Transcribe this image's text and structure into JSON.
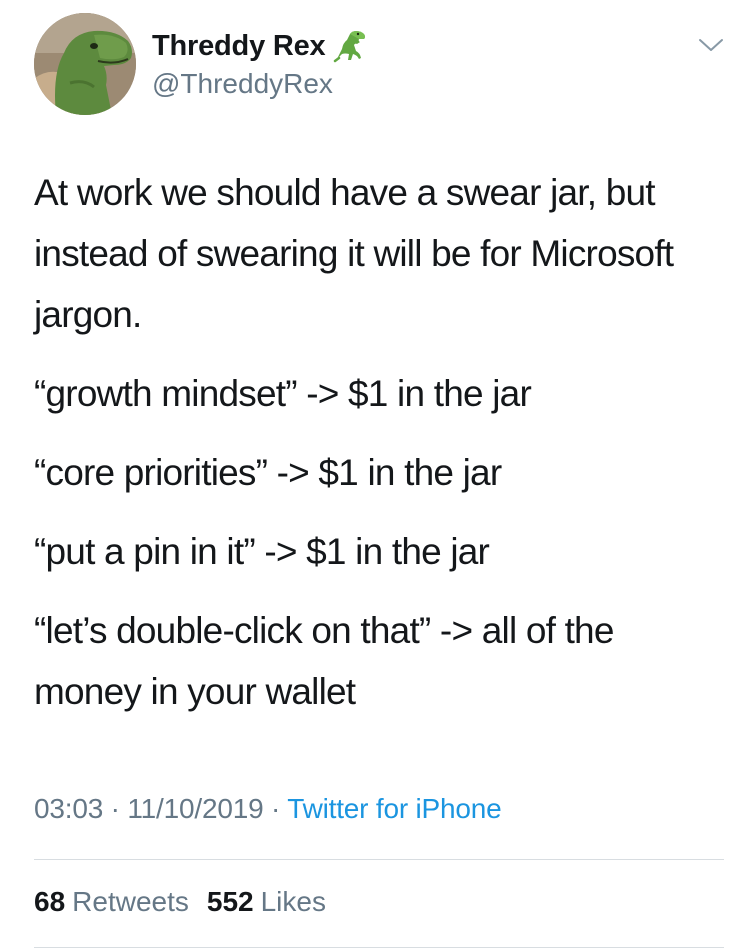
{
  "author": {
    "display_name": "Threddy Rex",
    "handle": "@ThreddyRex",
    "name_emoji": "t-rex-emoji"
  },
  "tweet": {
    "paragraphs": [
      "At work we should have a swear jar, but instead of swearing it will be for Microsoft jargon.",
      "“growth mindset” -> $1 in the jar",
      "“core priorities” -> $1 in the jar",
      "“put a pin in it” -> $1 in the jar",
      "“let’s double-click on that” -> all of the money in your wallet"
    ]
  },
  "meta": {
    "time": "03:03",
    "separator": "·",
    "date": "11/10/2019",
    "source": "Twitter for iPhone"
  },
  "stats": {
    "retweets_count": "68",
    "retweets_label": "Retweets",
    "likes_count": "552",
    "likes_label": "Likes"
  },
  "icons": {
    "menu": "chevron-down-icon"
  },
  "colors": {
    "text": "#14171a",
    "secondary": "#657786",
    "link": "#1b95e0",
    "divider": "#d8dde1"
  }
}
